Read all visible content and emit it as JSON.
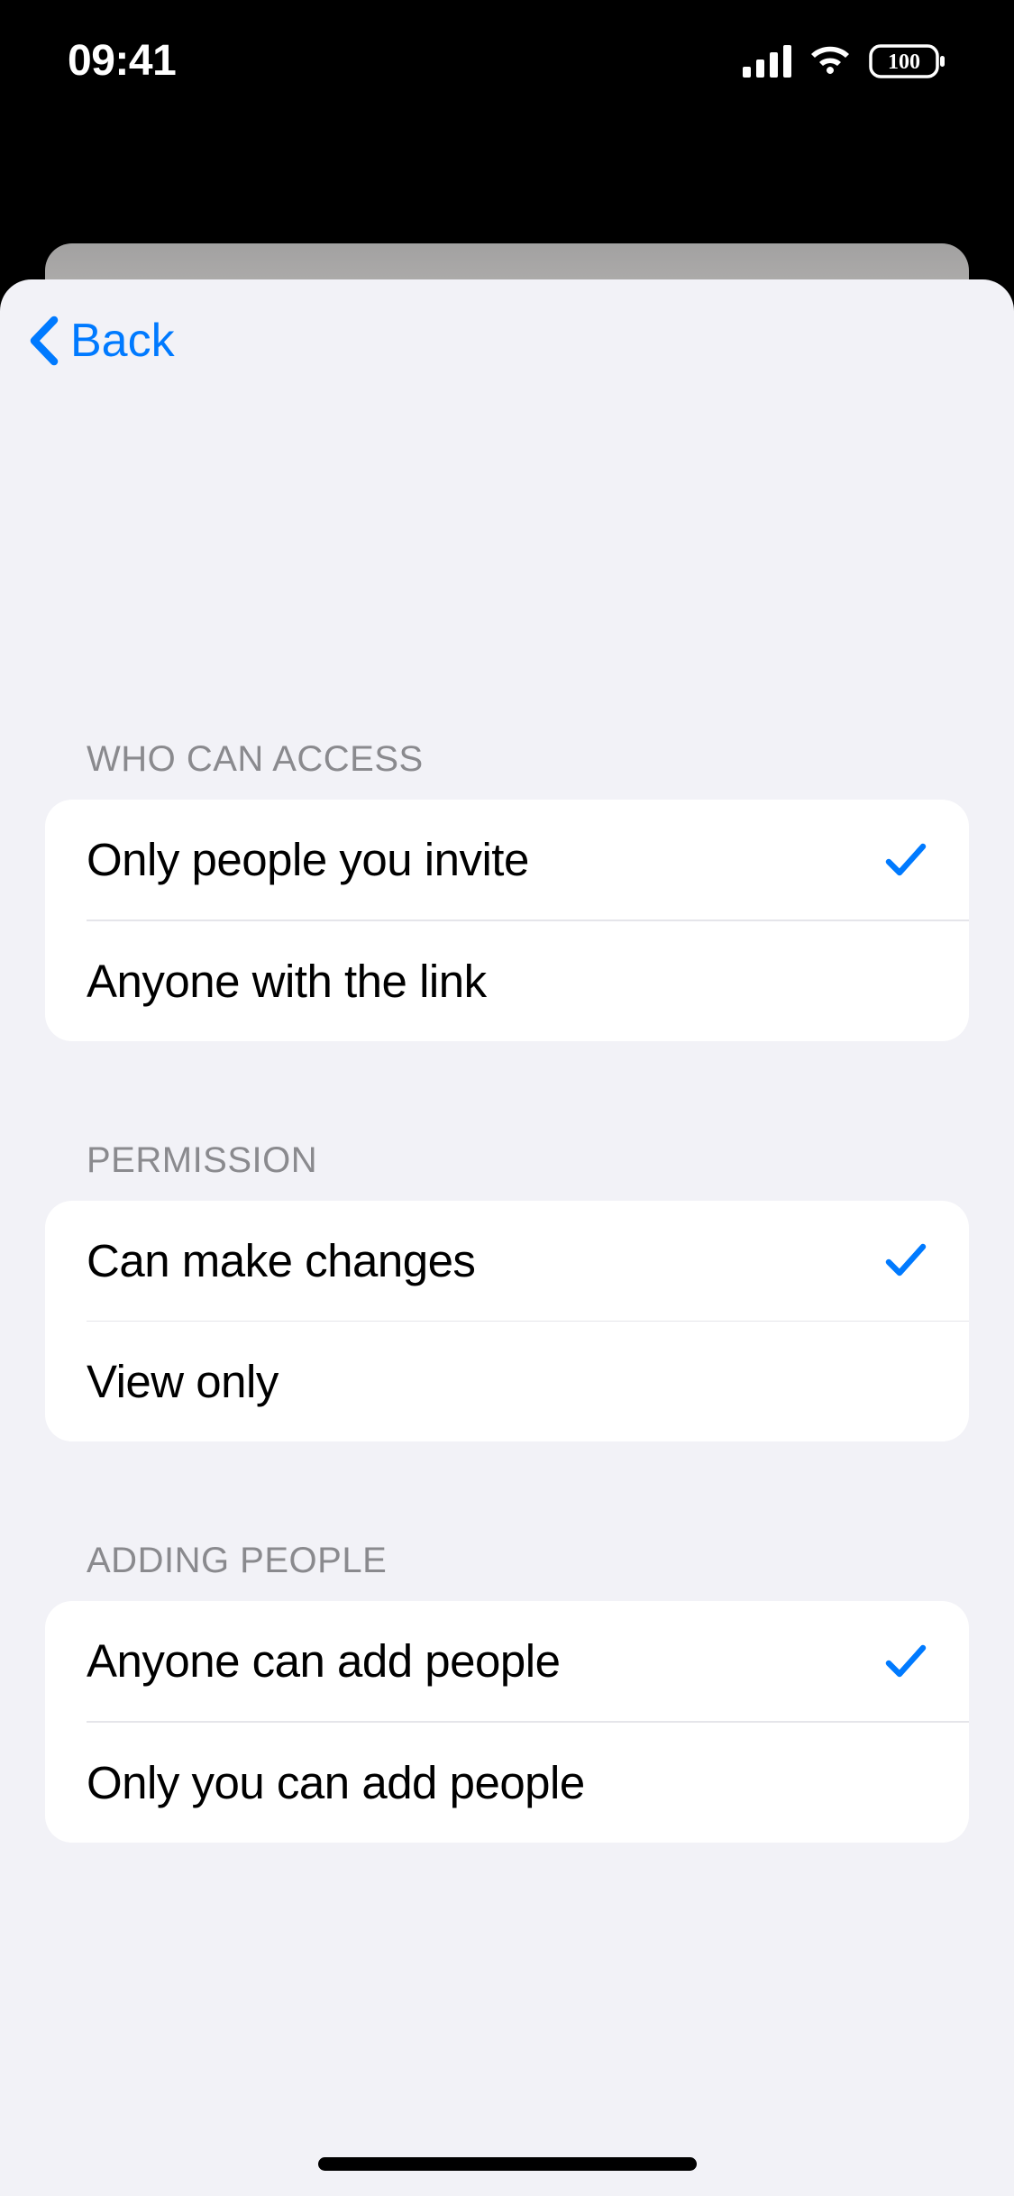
{
  "status": {
    "time": "09:41",
    "battery": "100"
  },
  "nav": {
    "back_label": "Back"
  },
  "sections": {
    "access": {
      "header": "WHO CAN ACCESS",
      "options": [
        {
          "label": "Only people you invite",
          "selected": true
        },
        {
          "label": "Anyone with the link",
          "selected": false
        }
      ]
    },
    "permission": {
      "header": "PERMISSION",
      "options": [
        {
          "label": "Can make changes",
          "selected": true
        },
        {
          "label": "View only",
          "selected": false
        }
      ]
    },
    "adding": {
      "header": "ADDING PEOPLE",
      "options": [
        {
          "label": "Anyone can add people",
          "selected": true
        },
        {
          "label": "Only you can add people",
          "selected": false
        }
      ]
    }
  }
}
